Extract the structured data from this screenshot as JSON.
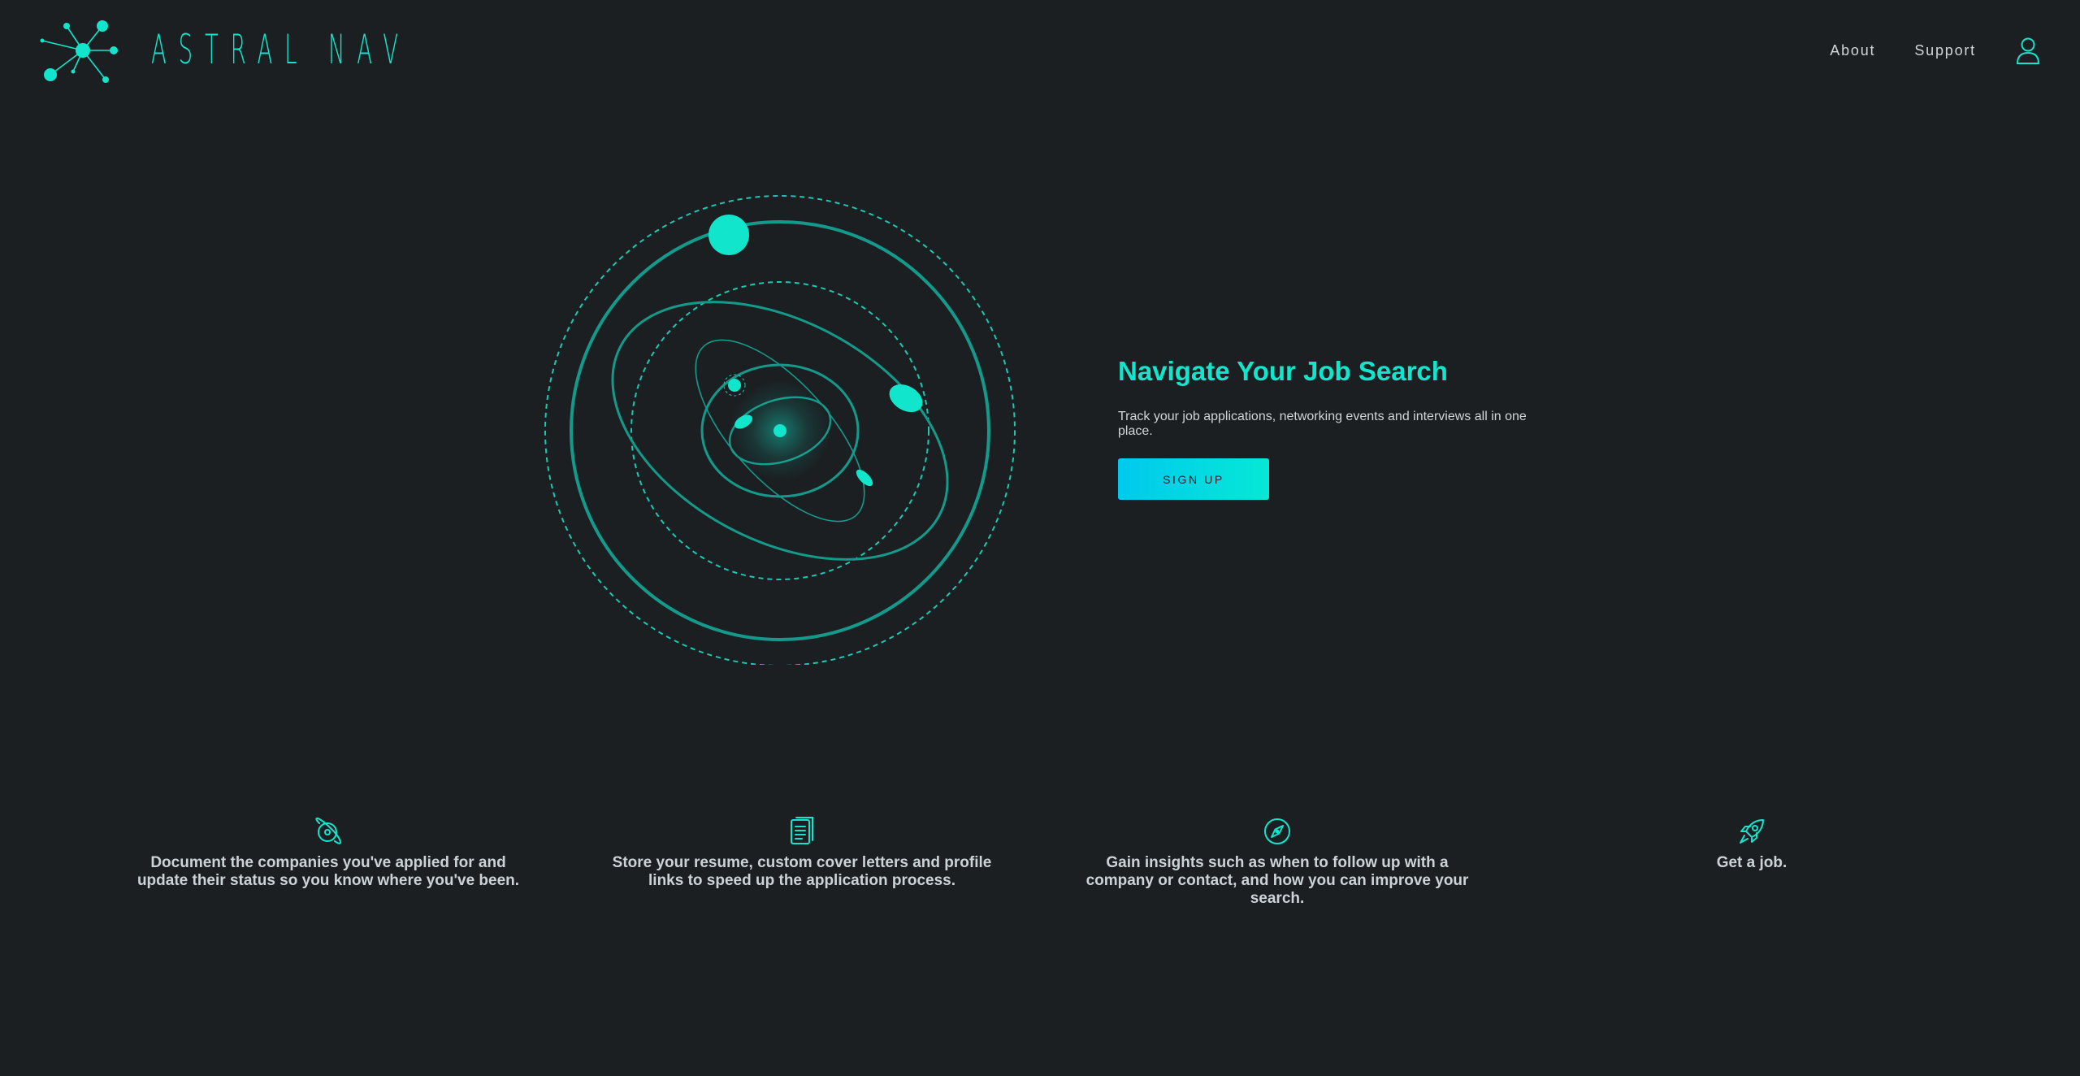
{
  "header": {
    "brand": "ASTRAL NAV",
    "nav": {
      "about": "About",
      "support": "Support"
    }
  },
  "hero": {
    "title": "Navigate Your Job Search",
    "subtitle": "Track your job applications, networking events and interviews all in one place.",
    "cta": "SIGN UP"
  },
  "features": [
    {
      "icon": "planet-icon",
      "text": "Document the companies you've applied for and update their status so you know where you've been."
    },
    {
      "icon": "document-icon",
      "text": "Store your resume, custom cover letters and profile links to speed up the application process."
    },
    {
      "icon": "compass-icon",
      "text": "Gain insights such as when to follow up with a company or contact, and how you can improve your search."
    },
    {
      "icon": "rocket-icon",
      "text": "Get a job."
    }
  ],
  "colors": {
    "background": "#1b1f22",
    "accent": "#11e6cc",
    "orbit": "#149a8a",
    "button_gradient_start": "#00c9ee",
    "button_gradient_end": "#06e8d6",
    "text": "#d0d6d8"
  }
}
